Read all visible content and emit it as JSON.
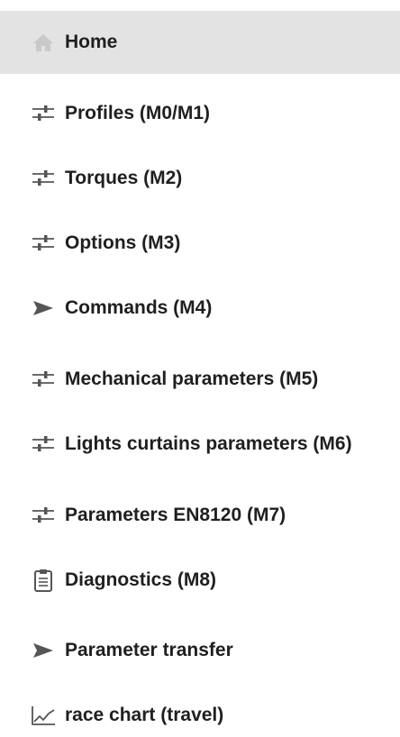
{
  "menu": {
    "items": [
      {
        "label": "Home",
        "icon": "home-icon",
        "active": true
      },
      {
        "label": "Profiles (M0/M1)",
        "icon": "sliders-icon"
      },
      {
        "label": "Torques (M2)",
        "icon": "sliders-icon"
      },
      {
        "label": "Options (M3)",
        "icon": "sliders-icon"
      },
      {
        "label": "Commands (M4)",
        "icon": "send-icon"
      },
      {
        "label": "Mechanical parameters (M5)",
        "icon": "sliders-icon"
      },
      {
        "label": "Lights curtains parameters (M6)",
        "icon": "sliders-icon"
      },
      {
        "label": "Parameters EN8120 (M7)",
        "icon": "sliders-icon"
      },
      {
        "label": "Diagnostics (M8)",
        "icon": "clipboard-icon"
      },
      {
        "label": "Parameter transfer",
        "icon": "send-icon"
      },
      {
        "label": "race chart (travel)",
        "icon": "line-chart-icon"
      }
    ]
  },
  "colors": {
    "active_background": "#e3e3e3",
    "text": "#1f1f1f",
    "icon": "#555555",
    "home_icon": "#c9c9c9"
  }
}
